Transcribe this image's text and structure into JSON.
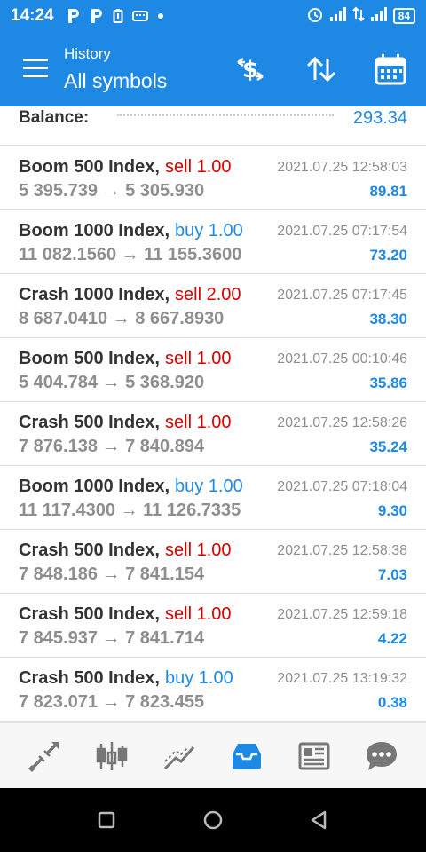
{
  "status_bar": {
    "time": "14:24",
    "battery": "84"
  },
  "header": {
    "subtitle": "History",
    "title": "All symbols",
    "color": "#1e88e5"
  },
  "balance": {
    "label": "Balance:",
    "value": "293.34"
  },
  "trades": [
    {
      "symbol": "Boom 500 Index,",
      "direction": "sell 1.00",
      "type": "sell",
      "prices": "5 395.739 → 5 305.930",
      "time": "2021.07.25 12:58:03",
      "profit": "89.81"
    },
    {
      "symbol": "Boom 1000 Index,",
      "direction": "buy 1.00",
      "type": "buy",
      "prices": "11 082.1560 → 11 155.3600",
      "time": "2021.07.25 07:17:54",
      "profit": "73.20"
    },
    {
      "symbol": "Crash 1000 Index,",
      "direction": "sell 2.00",
      "type": "sell",
      "prices": "8 687.0410 → 8 667.8930",
      "time": "2021.07.25 07:17:45",
      "profit": "38.30"
    },
    {
      "symbol": "Boom 500 Index,",
      "direction": "sell 1.00",
      "type": "sell",
      "prices": "5 404.784 → 5 368.920",
      "time": "2021.07.25 00:10:46",
      "profit": "35.86"
    },
    {
      "symbol": "Crash 500 Index,",
      "direction": "sell 1.00",
      "type": "sell",
      "prices": "7 876.138 → 7 840.894",
      "time": "2021.07.25 12:58:26",
      "profit": "35.24"
    },
    {
      "symbol": "Boom 1000 Index,",
      "direction": "buy 1.00",
      "type": "buy",
      "prices": "11 117.4300 → 11 126.7335",
      "time": "2021.07.25 07:18:04",
      "profit": "9.30"
    },
    {
      "symbol": "Crash 500 Index,",
      "direction": "sell 1.00",
      "type": "sell",
      "prices": "7 848.186 → 7 841.154",
      "time": "2021.07.25 12:58:38",
      "profit": "7.03"
    },
    {
      "symbol": "Crash 500 Index,",
      "direction": "sell 1.00",
      "type": "sell",
      "prices": "7 845.937 → 7 841.714",
      "time": "2021.07.25 12:59:18",
      "profit": "4.22"
    },
    {
      "symbol": "Crash 500 Index,",
      "direction": "buy 1.00",
      "type": "buy",
      "prices": "7 823.071 → 7 823.455",
      "time": "2021.07.25 13:19:32",
      "profit": "0.38"
    }
  ],
  "bottom_nav": [
    {
      "icon": "quotes-icon",
      "active": false
    },
    {
      "icon": "chart-icon",
      "active": false
    },
    {
      "icon": "trade-icon",
      "active": false
    },
    {
      "icon": "history-icon",
      "active": true
    },
    {
      "icon": "news-icon",
      "active": false
    },
    {
      "icon": "chat-icon",
      "active": false
    }
  ],
  "colors": {
    "accent": "#1e88e5",
    "sell": "#d50000",
    "buy": "#1e88e5",
    "inactive_icon": "#777777"
  }
}
